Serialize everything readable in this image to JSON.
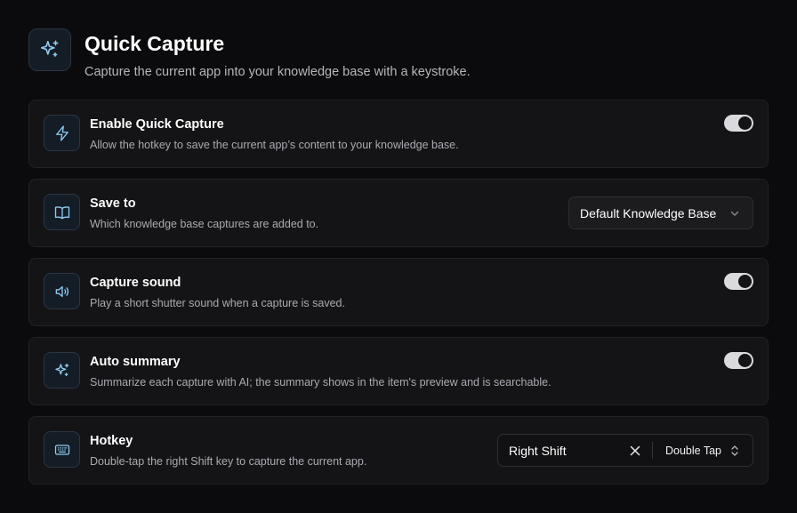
{
  "colors": {
    "background": "#0b0b0d",
    "card": "#141416",
    "icon_accent": "#8fcbf0",
    "toggle_on": "#d9d9de"
  },
  "header": {
    "icon": "sparkles-icon",
    "title": "Quick Capture",
    "subtitle": "Capture the current app into your knowledge base with a keystroke."
  },
  "settings": {
    "enable": {
      "icon": "lightning-icon",
      "title": "Enable Quick Capture",
      "description": "Allow the hotkey to save the current app’s content to your knowledge base.",
      "enabled": true
    },
    "save_to": {
      "icon": "book-icon",
      "title": "Save to",
      "description": "Which knowledge base captures are added to.",
      "selected": "Default Knowledge Base"
    },
    "sound": {
      "icon": "speaker-icon",
      "title": "Capture sound",
      "description": "Play a short shutter sound when a capture is saved.",
      "enabled": true
    },
    "summary": {
      "icon": "sparkles-icon",
      "title": "Auto summary",
      "description": "Summarize each capture with AI; the summary shows in the item's preview and is searchable.",
      "enabled": true
    },
    "hotkey": {
      "icon": "keyboard-icon",
      "title": "Hotkey",
      "description": "Double-tap the right Shift key to capture the current app.",
      "key": "Right Shift",
      "mode": "Double Tap"
    }
  }
}
